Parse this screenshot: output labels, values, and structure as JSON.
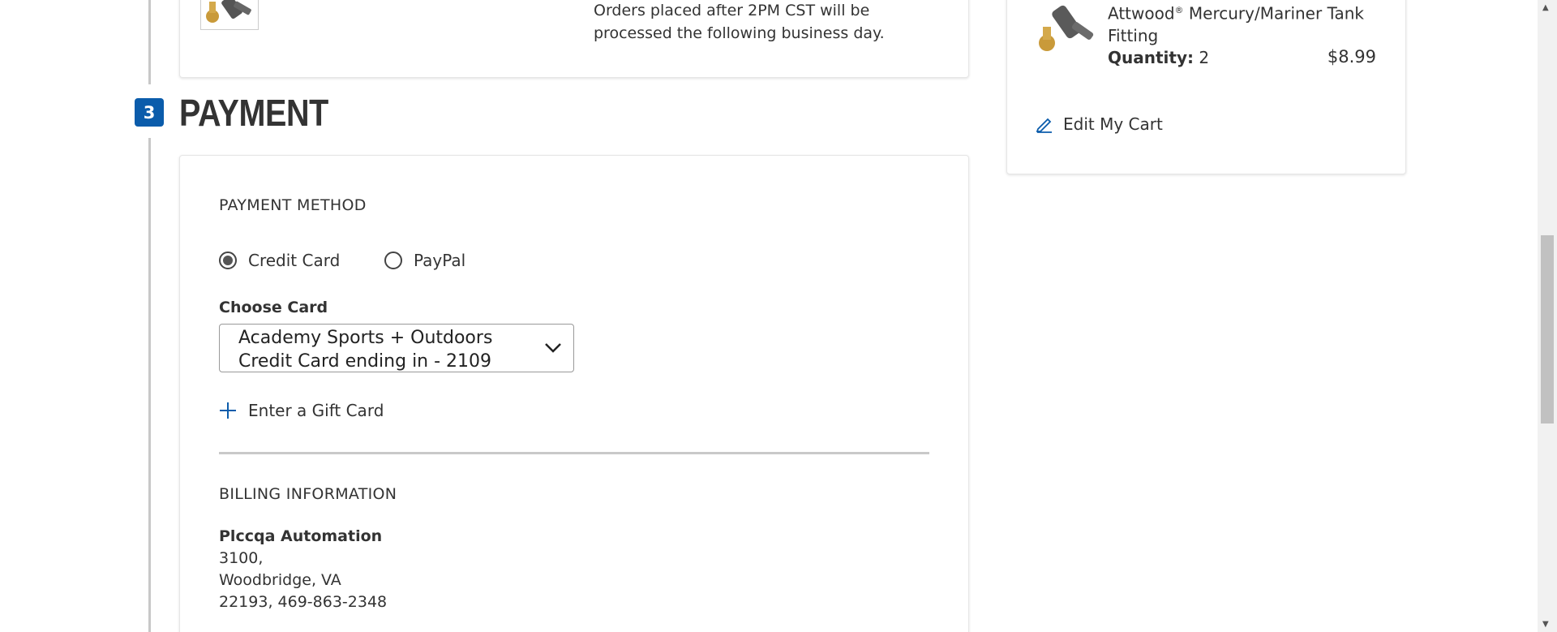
{
  "shipping": {
    "note": "Orders placed after 2PM CST will be processed the following business day."
  },
  "payment_step": {
    "number": "3",
    "title": "PAYMENT"
  },
  "payment_method": {
    "heading": "PAYMENT METHOD",
    "options": [
      {
        "label": "Credit Card",
        "selected": true
      },
      {
        "label": "PayPal",
        "selected": false
      }
    ],
    "choose_card_label": "Choose Card",
    "selected_card": "Academy Sports + Outdoors Credit Card ending in - 2109",
    "gift_card_link": "Enter a Gift Card"
  },
  "billing": {
    "heading": "BILLING INFORMATION",
    "name": "Plccqa Automation",
    "line1": "3100,",
    "line2": "Woodbridge, VA",
    "line3": "22193, 469-863-2348"
  },
  "order_summary": {
    "item_name_part1": "Attwood",
    "item_name_sup": "®",
    "item_name_part2": " Mercury/Mariner Tank Fitting",
    "quantity_label": "Quantity:",
    "quantity_value": "2",
    "price": "$8.99",
    "edit_cart_label": "Edit My Cart"
  },
  "colors": {
    "accent": "#0b5cab",
    "text": "#333333",
    "rail": "#c8c8c8"
  },
  "icons": {
    "edit": "pencil-icon",
    "add": "plus-icon",
    "dropdown": "chevron-down-icon"
  }
}
